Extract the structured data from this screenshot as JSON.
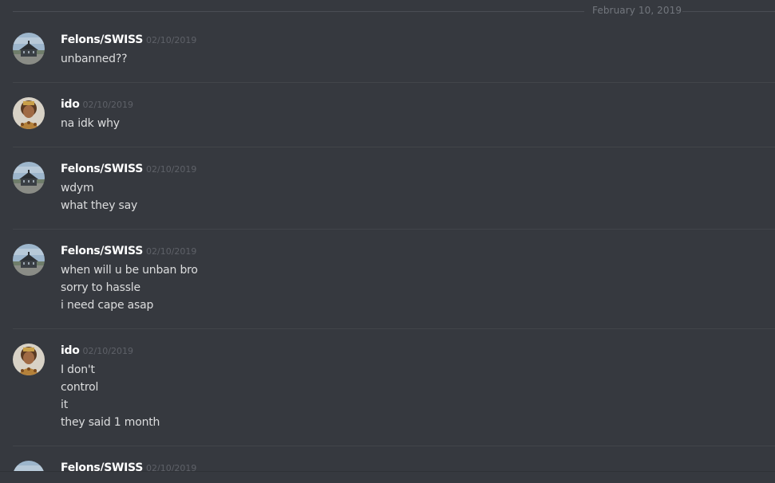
{
  "date_divider": {
    "text": "February 10, 2019"
  },
  "messages": [
    {
      "author": "Felons/SWISS",
      "timestamp": "02/10/2019",
      "avatar": "building-avatar",
      "lines": [
        "unbanned??"
      ]
    },
    {
      "author": "ido",
      "timestamp": "02/10/2019",
      "avatar": "person-avatar",
      "lines": [
        "na idk why"
      ]
    },
    {
      "author": "Felons/SWISS",
      "timestamp": "02/10/2019",
      "avatar": "building-avatar",
      "lines": [
        "wdym",
        "what they say"
      ]
    },
    {
      "author": "Felons/SWISS",
      "timestamp": "02/10/2019",
      "avatar": "building-avatar",
      "lines": [
        "when will u be unban bro",
        "sorry to hassle",
        "i need cape asap"
      ]
    },
    {
      "author": "ido",
      "timestamp": "02/10/2019",
      "avatar": "person-avatar",
      "lines": [
        "I don't",
        "control",
        "it",
        "they said 1 month"
      ]
    },
    {
      "author": "Felons/SWISS",
      "timestamp": "02/10/2019",
      "avatar": "building-avatar",
      "lines": []
    }
  ],
  "colors": {
    "background": "#36393f",
    "username": "#ffffff",
    "message_text": "#dcddde",
    "timestamp": "#5e6168",
    "divider": "#42454a"
  }
}
